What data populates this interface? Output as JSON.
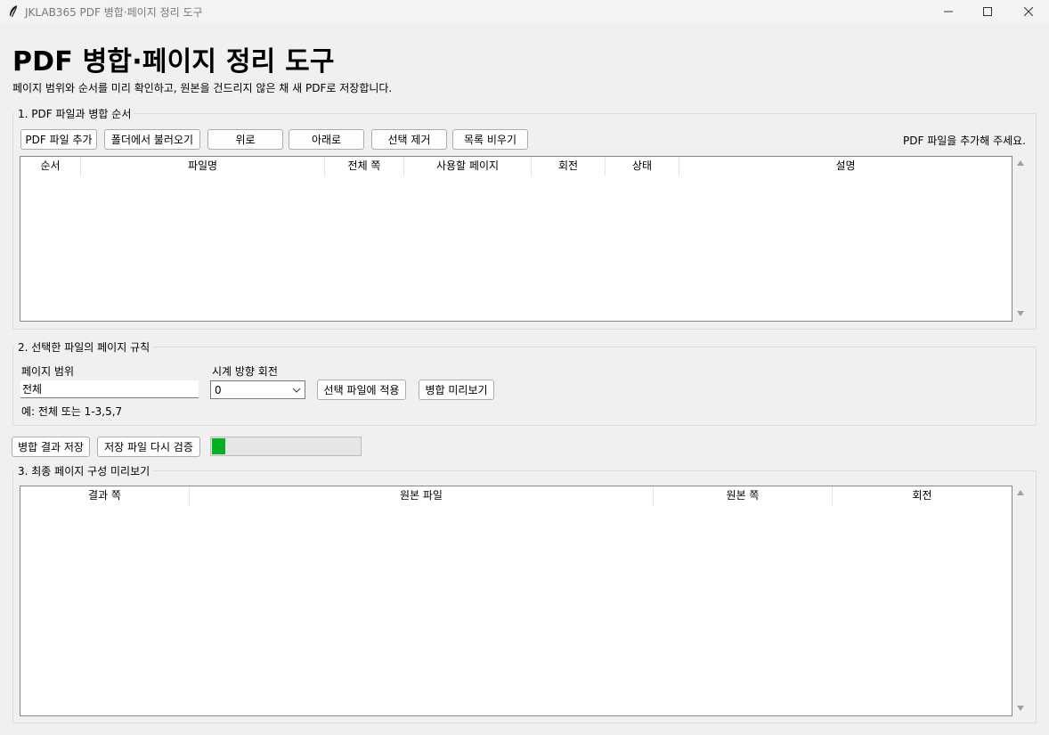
{
  "window": {
    "title": "JKLAB365 PDF 병합·페이지 정리 도구"
  },
  "header": {
    "title": "PDF 병합·페이지 정리 도구",
    "subtitle": "페이지 범위와 순서를 미리 확인하고, 원본을 건드리지 않은 채 새 PDF로 저장합니다."
  },
  "files_section": {
    "label": "1. PDF 파일과 병합 순서",
    "buttons": {
      "add_pdf": "PDF 파일 추가",
      "load_folder": "폴더에서 불러오기",
      "move_up": "위로",
      "move_down": "아래로",
      "remove_selected": "선택 제거",
      "clear_list": "목록 비우기"
    },
    "status": "PDF 파일을 추가해 주세요.",
    "columns": [
      "순서",
      "파일명",
      "전체 쪽",
      "사용할 페이지",
      "회전",
      "상태",
      "설명"
    ],
    "rows": []
  },
  "rules_section": {
    "label": "2. 선택한 파일의 페이지 규칙",
    "page_range_label": "페이지 범위",
    "page_range_value": "전체",
    "rotation_label": "시계 방향 회전",
    "rotation_value": "0",
    "apply_button": "선택 파일에 적용",
    "preview_button": "병합 미리보기",
    "hint": "예: 전체 또는 1-3,5,7"
  },
  "actions": {
    "save_button": "병합 결과 저장",
    "verify_button": "저장 파일 다시 검증",
    "progress_percent": 10
  },
  "preview_section": {
    "label": "3. 최종 페이지 구성 미리보기",
    "columns": [
      "결과 쪽",
      "원본 파일",
      "원본 쪽",
      "회전"
    ],
    "rows": []
  },
  "colors": {
    "progress_fill": "#06b025",
    "window_bg": "#f0f0f0"
  }
}
